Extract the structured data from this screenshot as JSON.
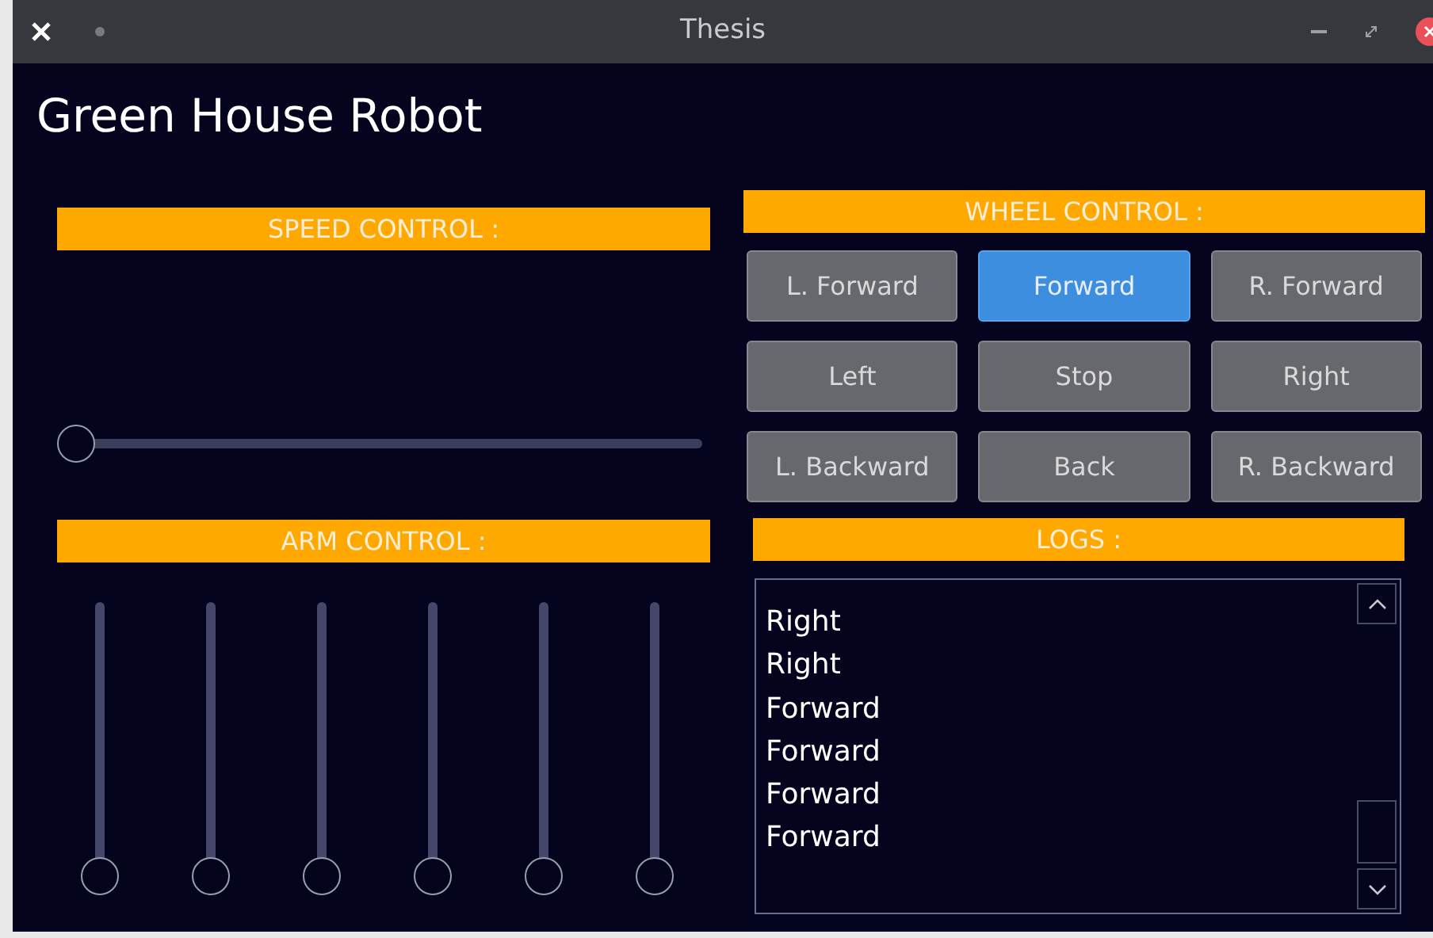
{
  "window": {
    "title": "Thesis"
  },
  "app_title": "Green House Robot",
  "speed_control": {
    "label": "SPEED CONTROL :",
    "slider": {
      "level": 0
    }
  },
  "wheel_control": {
    "label": "WHEEL CONTROL :",
    "buttons": [
      {
        "label": "L. Forward",
        "selected": false
      },
      {
        "label": "Forward",
        "selected": true
      },
      {
        "label": "R. Forward",
        "selected": false
      },
      {
        "label": "Left",
        "selected": false
      },
      {
        "label": "Stop",
        "selected": false
      },
      {
        "label": "Right",
        "selected": false
      },
      {
        "label": "L. Backward",
        "selected": false
      },
      {
        "label": "Back",
        "selected": false
      },
      {
        "label": "R. Backward",
        "selected": false
      }
    ]
  },
  "arm_control": {
    "label": "ARM CONTROL :",
    "sliders": [
      {
        "level": 0
      },
      {
        "level": 0
      },
      {
        "level": 0
      },
      {
        "level": 0
      },
      {
        "level": 0
      },
      {
        "level": 0
      }
    ]
  },
  "logs": {
    "label": "LOGS :",
    "entries": [
      "Right",
      "Right",
      "Forward",
      "Forward",
      "Forward",
      "Forward"
    ]
  }
}
